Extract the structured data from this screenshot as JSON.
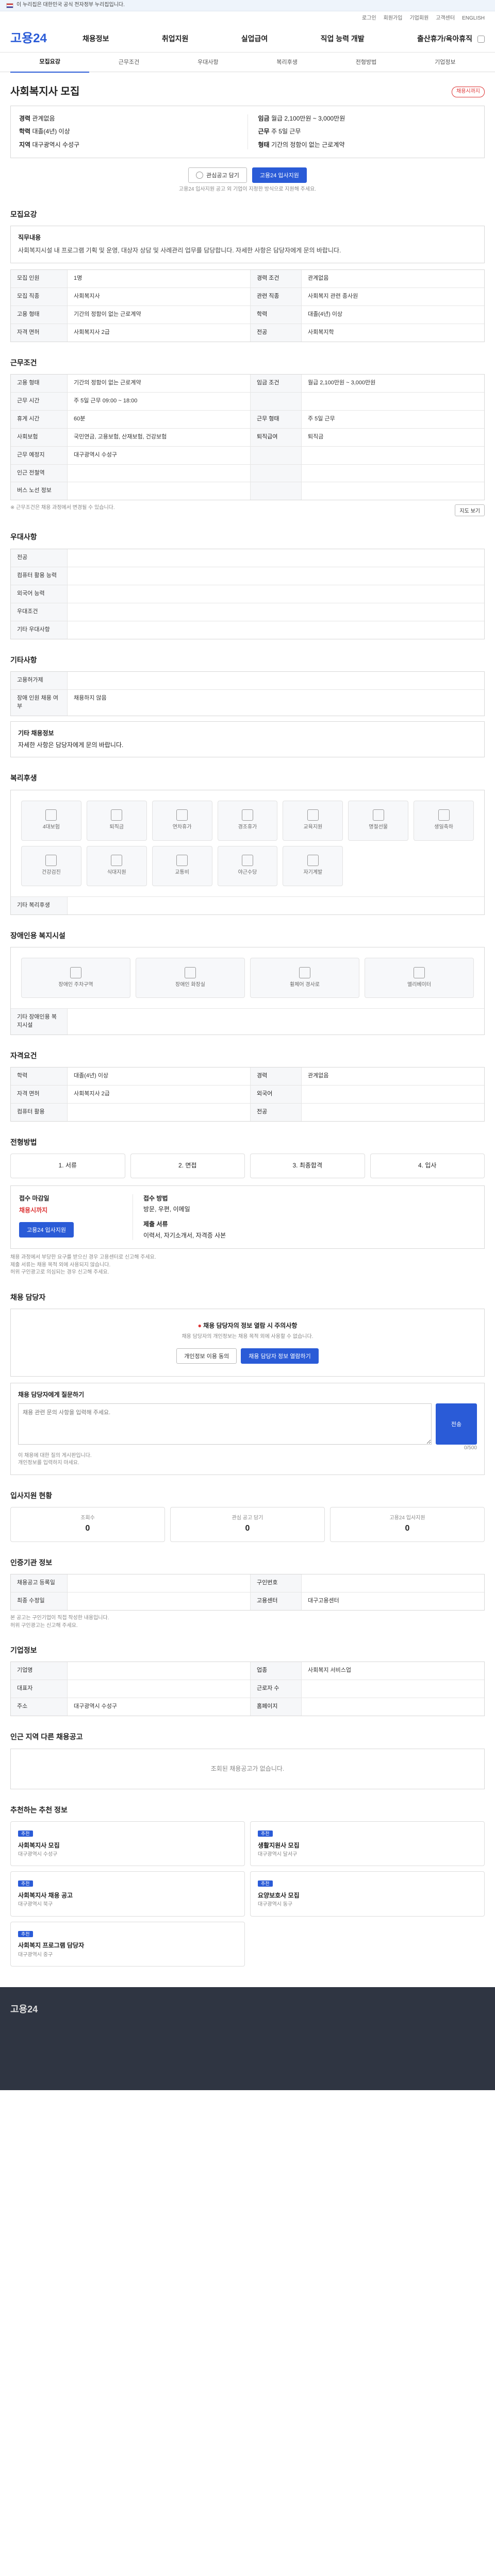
{
  "topbar": {
    "text": "이 누리집은 대한민국 공식 전자정부 누리집입니다."
  },
  "util": [
    "로그인",
    "회원가입",
    "기업회원",
    "고객센터",
    "ENGLISH"
  ],
  "header": {
    "logo": "고용24",
    "gnb": [
      "채용정보",
      "취업지원",
      "실업급여",
      "직업 능력 개발",
      "출산휴가/육아휴직"
    ]
  },
  "tabs": [
    "모집요강",
    "근무조건",
    "우대사항",
    "복리후생",
    "전형방법",
    "기업정보"
  ],
  "job": {
    "title": "사회복지사 모집",
    "badge": "채용시까지",
    "summary_left": [
      {
        "k": "경력",
        "v": "관계없음"
      },
      {
        "k": "학력",
        "v": "대졸(4년) 이상"
      },
      {
        "k": "지역",
        "v": "대구광역시 수성구"
      }
    ],
    "summary_right": [
      {
        "k": "임금",
        "v": "월급 2,100만원 ~ 3,000만원"
      },
      {
        "k": "근무",
        "v": "주 5일 근무"
      },
      {
        "k": "형태",
        "v": "기간의 정함이 없는 근로계약"
      }
    ],
    "scrap": "관심공고 담기",
    "apply": "고용24 입사지원",
    "note": "고용24 입사지원 공고 외 기업이 지정한 방식으로 지원해 주세요."
  },
  "recruit": {
    "title": "모집요강",
    "duty_label": "직무내용",
    "duty": "사회복지시설 내 프로그램 기획 및 운영, 대상자 상담 및 사례관리 업무를 담당합니다. 자세한 사항은 담당자에게 문의 바랍니다.",
    "rows": [
      {
        "k": "모집 인원",
        "v": "1명",
        "k2": "경력 조건",
        "v2": "관계없음"
      },
      {
        "k": "모집 직종",
        "v": "사회복지사",
        "k2": "관련 직종",
        "v2": "사회복지 관련 종사원"
      },
      {
        "k": "고용 형태",
        "v": "기간의 정함이 없는 근로계약",
        "k2": "학력",
        "v2": "대졸(4년) 이상"
      },
      {
        "k": "자격 면허",
        "v": "사회복지사 2급",
        "k2": "전공",
        "v2": "사회복지학"
      }
    ]
  },
  "work": {
    "title": "근무조건",
    "rows": [
      {
        "k": "고용 형태",
        "v": "기간의 정함이 없는 근로계약",
        "k2": "임금 조건",
        "v2": "월급 2,100만원 ~ 3,000만원"
      },
      {
        "k": "근무 시간",
        "v": "주 5일 근무 09:00 ~ 18:00",
        "k2": "",
        "v2": ""
      },
      {
        "k": "휴게 시간",
        "v": "60분",
        "k2": "근무 형태",
        "v2": "주 5일 근무"
      },
      {
        "k": "사회보험",
        "v": "국민연금, 고용보험, 산재보험, 건강보험",
        "k2": "퇴직급여",
        "v2": "퇴직금"
      },
      {
        "k": "근무 예정지",
        "v": "대구광역시 수성구",
        "k2": "",
        "v2": ""
      },
      {
        "k": "인근 전철역",
        "v": "",
        "k2": "",
        "v2": ""
      },
      {
        "k": "버스 노선 정보",
        "v": "",
        "k2": "",
        "v2": ""
      }
    ],
    "map_button": "지도 보기",
    "footnote": "※ 근무조건은 채용 과정에서 변경될 수 있습니다."
  },
  "pref": {
    "title": "우대사항",
    "rows": [
      {
        "k": "전공",
        "v": ""
      },
      {
        "k": "컴퓨터 활용 능력",
        "v": ""
      },
      {
        "k": "외국어 능력",
        "v": ""
      },
      {
        "k": "우대조건",
        "v": ""
      },
      {
        "k": "기타 우대사항",
        "v": ""
      }
    ]
  },
  "etc": {
    "title": "기타사항",
    "rows": [
      {
        "k": "고용허가제",
        "v": ""
      },
      {
        "k": "장애 인원 채용 여부",
        "v": "채용하지 않음"
      }
    ],
    "extra_label": "기타 채용정보",
    "extra": "자세한 사항은 담당자에게 문의 바랍니다."
  },
  "welfare": {
    "title": "복리후생",
    "items": [
      "4대보험",
      "퇴직금",
      "연차휴가",
      "경조휴가",
      "교육지원",
      "명절선물",
      "생일축하",
      "건강검진",
      "식대지원",
      "교통비",
      "야근수당",
      "자기계발"
    ],
    "other_label": "기타 복리후생",
    "other": ""
  },
  "disability": {
    "title": "장애인용 복지시설",
    "items": [
      "장애인 주차구역",
      "장애인 화장실",
      "휠체어 경사로",
      "엘리베이터"
    ],
    "other_label": "기타 장애인용 복지시설",
    "other": ""
  },
  "qual": {
    "title": "자격요건",
    "rows": [
      {
        "k": "학력",
        "v": "대졸(4년) 이상",
        "k2": "경력",
        "v2": "관계없음"
      },
      {
        "k": "자격 면허",
        "v": "사회복지사 2급",
        "k2": "외국어",
        "v2": ""
      },
      {
        "k": "컴퓨터 활용",
        "v": "",
        "k2": "전공",
        "v2": ""
      }
    ]
  },
  "select": {
    "title": "전형방법",
    "steps": [
      "서류",
      "면접",
      "최종합격",
      "입사"
    ],
    "docs_label": "접수 마감일",
    "deadline": "채용시까지",
    "method_label": "접수 방법",
    "method": "방문, 우편, 이메일",
    "docs2_label": "제출 서류",
    "docs2": "이력서, 자기소개서, 자격증 사본",
    "apply2": "고용24 입사지원",
    "notices": [
      "채용 과정에서 부당한 요구를 받으신 경우 고용센터로 신고해 주세요.",
      "제출 서류는 채용 목적 외에 사용되지 않습니다.",
      "허위 구인광고로 의심되는 경우 신고해 주세요."
    ]
  },
  "contact": {
    "title": "채용 담당자",
    "alert": "채용 담당자의 정보 열람 시 주의사항",
    "alert_text": "채용 담당자의 개인정보는 채용 목적 외에 사용할 수 없습니다.",
    "btn1": "개인정보 이용 동의",
    "btn2": "채용 담당자 정보 열람하기",
    "q_label": "채용 담당자에게 질문하기",
    "q_placeholder": "채용 관련 문의 사항을 입력해 주세요.",
    "q_count": "0/500",
    "send": "전송",
    "q_notes": [
      "이 채용에 대한 질의 게시판입니다.",
      "개인정보를 입력하지 마세요."
    ]
  },
  "status": {
    "title": "입사지원 현황",
    "items": [
      {
        "k": "조회수",
        "v": "0"
      },
      {
        "k": "관심 공고 담기",
        "v": "0"
      },
      {
        "k": "고용24 입사지원",
        "v": "0"
      }
    ]
  },
  "info": {
    "title": "인증기관 정보",
    "rows": [
      {
        "k": "채용공고 등록일",
        "v": "",
        "k2": "구인번호",
        "v2": ""
      },
      {
        "k": "최종 수정일",
        "v": "",
        "k2": "고용센터",
        "v2": "대구고용센터"
      }
    ],
    "notes": [
      "본 공고는 구인기업이 직접 작성한 내용입니다.",
      "허위 구인광고는 신고해 주세요."
    ]
  },
  "company": {
    "title": "기업정보",
    "rows": [
      {
        "k": "기업명",
        "v": "",
        "k2": "업종",
        "v2": "사회복지 서비스업"
      },
      {
        "k": "대표자",
        "v": "",
        "k2": "근로자 수",
        "v2": ""
      },
      {
        "k": "주소",
        "v": "대구광역시 수성구",
        "k2": "홈페이지",
        "v2": ""
      }
    ]
  },
  "other": {
    "title": "인근 지역 다른 채용공고",
    "empty": "조회된 채용공고가 없습니다."
  },
  "related": {
    "title": "추천하는 추천 정보",
    "cards": [
      {
        "tag": "추천",
        "title": "사회복지사 모집",
        "sub": "대구광역시 수성구"
      },
      {
        "tag": "추천",
        "title": "생활지원사 모집",
        "sub": "대구광역시 달서구"
      },
      {
        "tag": "추천",
        "title": "사회복지사 채용 공고",
        "sub": "대구광역시 북구"
      },
      {
        "tag": "추천",
        "title": "요양보호사 모집",
        "sub": "대구광역시 동구"
      },
      {
        "tag": "추천",
        "title": "사회복지 프로그램 담당자",
        "sub": "대구광역시 중구"
      }
    ]
  }
}
